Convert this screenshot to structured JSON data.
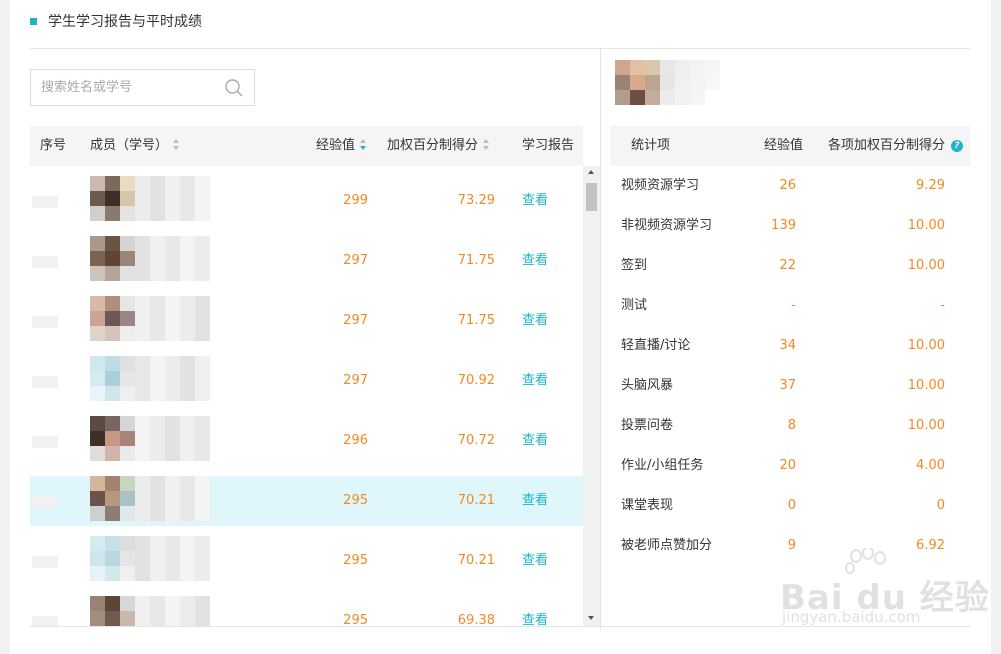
{
  "header": {
    "title": "学生学习报告与平时成绩"
  },
  "search": {
    "placeholder": "搜索姓名或学号",
    "icon": "search-icon"
  },
  "left_table": {
    "columns": {
      "index": "序号",
      "member": "成员（学号）",
      "exp": "经验值",
      "score": "加权百分制得分",
      "report": "学习报告"
    },
    "rows": [
      {
        "exp": "299",
        "score": "73.29",
        "report": "查看"
      },
      {
        "exp": "297",
        "score": "71.75",
        "report": "查看"
      },
      {
        "exp": "297",
        "score": "71.75",
        "report": "查看"
      },
      {
        "exp": "297",
        "score": "70.92",
        "report": "查看"
      },
      {
        "exp": "296",
        "score": "70.72",
        "report": "查看"
      },
      {
        "exp": "295",
        "score": "70.21",
        "report": "查看",
        "highlighted": true
      },
      {
        "exp": "295",
        "score": "70.21",
        "report": "查看"
      },
      {
        "exp": "295",
        "score": "69.38",
        "report": "查看"
      }
    ]
  },
  "right_table": {
    "columns": {
      "item": "统计项",
      "exp": "经验值",
      "score": "各项加权百分制得分"
    },
    "rows": [
      {
        "item": "视频资源学习",
        "exp": "26",
        "score": "9.29"
      },
      {
        "item": "非视频资源学习",
        "exp": "139",
        "score": "10.00"
      },
      {
        "item": "签到",
        "exp": "22",
        "score": "10.00"
      },
      {
        "item": "测试",
        "exp": "-",
        "score": "-"
      },
      {
        "item": "轻直播/讨论",
        "exp": "34",
        "score": "10.00"
      },
      {
        "item": "头脑风暴",
        "exp": "37",
        "score": "10.00"
      },
      {
        "item": "投票问卷",
        "exp": "8",
        "score": "10.00"
      },
      {
        "item": "作业/小组任务",
        "exp": "20",
        "score": "4.00"
      },
      {
        "item": "课堂表现",
        "exp": "0",
        "score": "0"
      },
      {
        "item": "被老师点赞加分",
        "exp": "9",
        "score": "6.92"
      }
    ]
  },
  "watermark": {
    "brand": "Bai du 经验",
    "url": "jingyan.baidu.com"
  },
  "colors": {
    "accent": "#1fb5c9",
    "number": "#f08a24",
    "highlight": "#dff6fa"
  }
}
